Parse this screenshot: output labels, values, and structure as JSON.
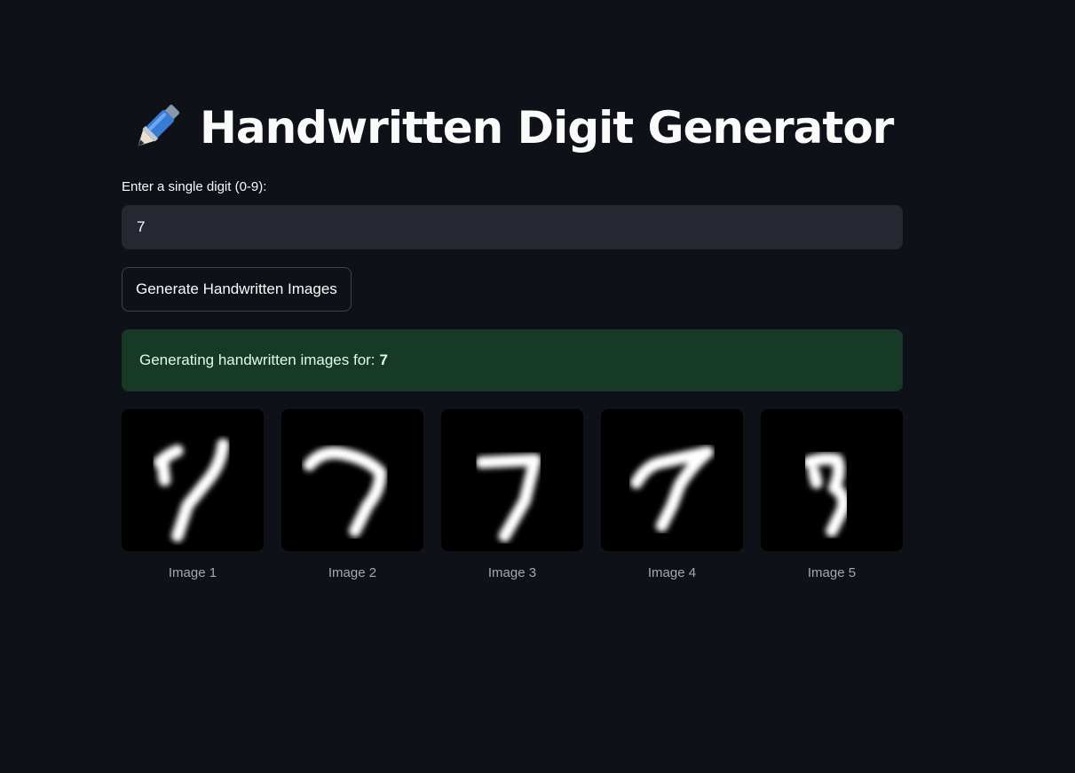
{
  "header": {
    "title": "Handwritten Digit Generator",
    "title_icon": "pen-icon"
  },
  "digit_input": {
    "label": "Enter a single digit (0-9):",
    "value": "7"
  },
  "generate_button": {
    "label": "Generate Handwritten Images"
  },
  "status": {
    "prefix": "Generating handwritten images for:",
    "digit": "7",
    "color": "#173928"
  },
  "images": [
    {
      "caption": "Image 1"
    },
    {
      "caption": "Image 2"
    },
    {
      "caption": "Image 3"
    },
    {
      "caption": "Image 4"
    },
    {
      "caption": "Image 5"
    }
  ],
  "colors": {
    "background": "#0e1117",
    "input_background": "#262730",
    "success_background": "#173928"
  }
}
